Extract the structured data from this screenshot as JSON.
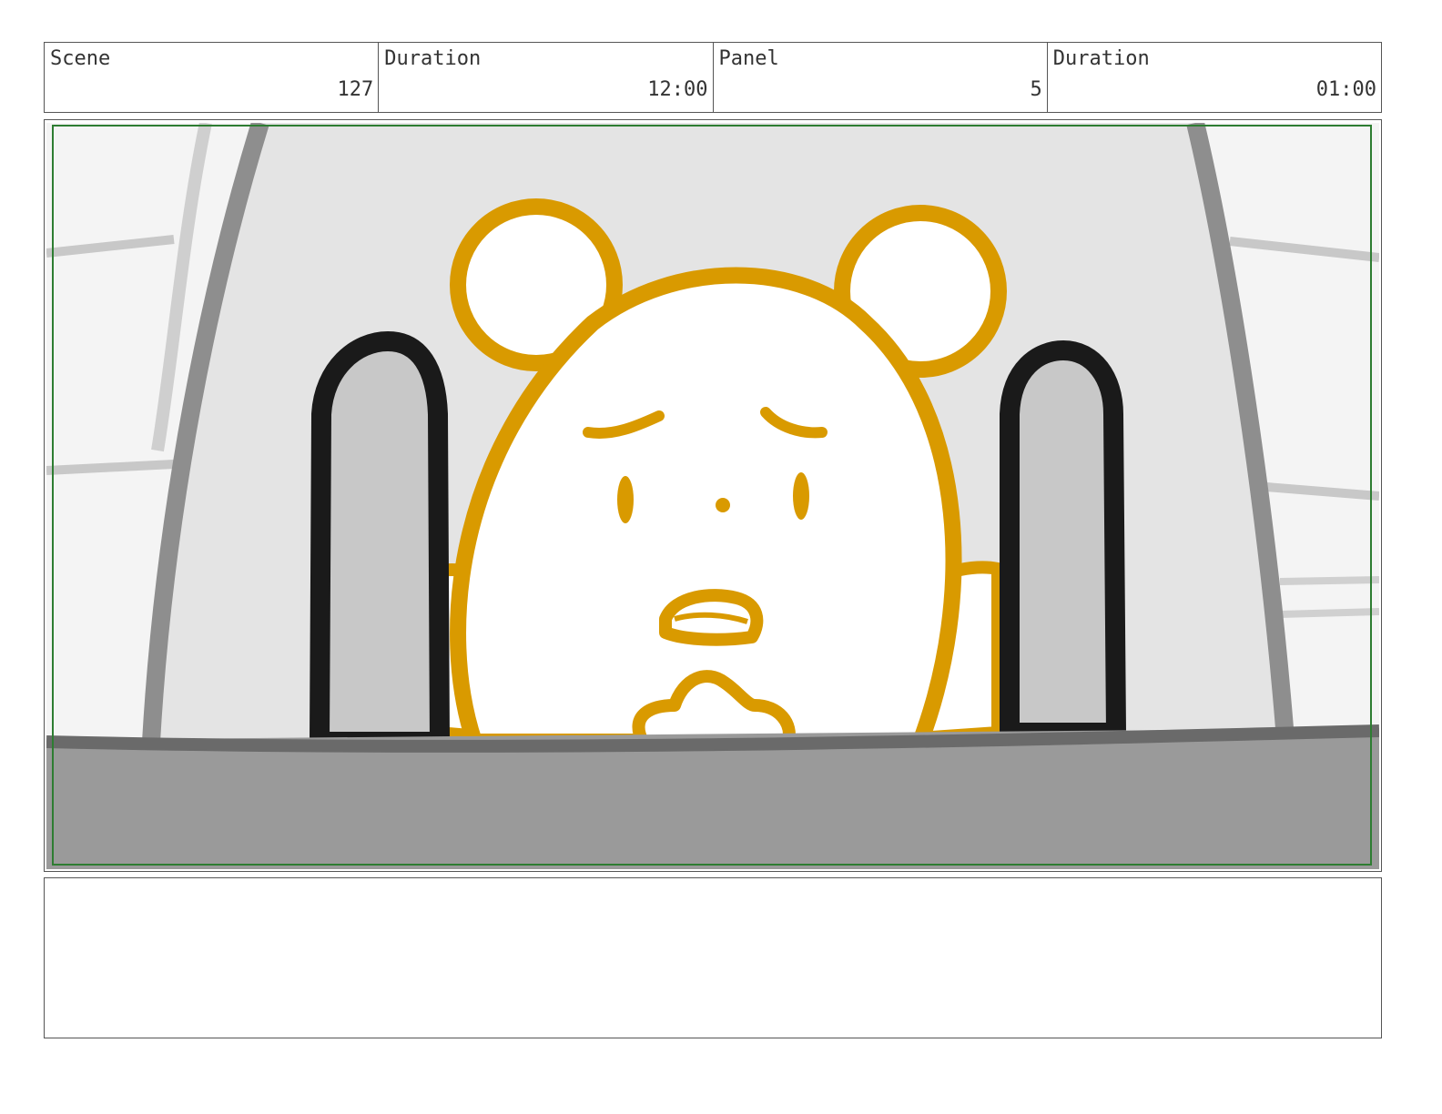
{
  "header": {
    "scene_label": "Scene",
    "scene_value": "127",
    "scene_duration_label": "Duration",
    "scene_duration_value": "12:00",
    "panel_label": "Panel",
    "panel_value": "5",
    "panel_duration_label": "Duration",
    "panel_duration_value": "01:00"
  },
  "colors": {
    "bear_outline": "#d99a00",
    "seat_back": "#e4e4e4",
    "seat_edge": "#8e8e8e",
    "headrest_outline": "#1a1a1a",
    "headrest_fill": "#c8c8c8",
    "dashboard": "#9a9a9a",
    "safe_frame": "#2e7d32"
  },
  "notes": {
    "text": ""
  }
}
